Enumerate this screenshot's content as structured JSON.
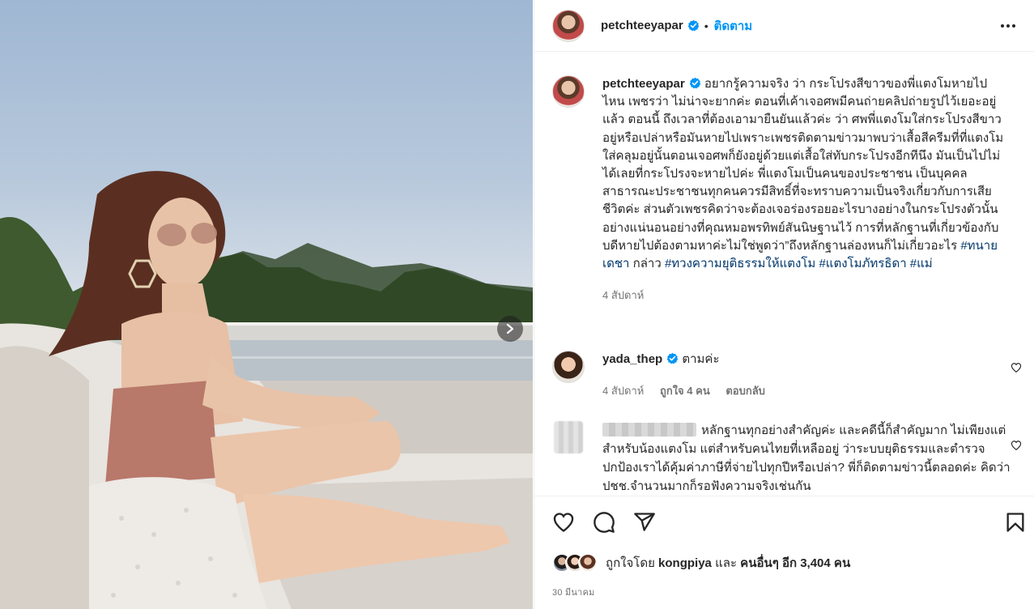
{
  "header": {
    "username": "petchteeyapar",
    "separator": "•",
    "follow_label": "ติดตาม"
  },
  "caption": {
    "username": "petchteeyapar",
    "text": "อยากรู้ความจริง ว่า กระโปรงสีขาวของพี่แตงโมหายไปไหน เพชรว่า ไม่น่าจะยากค่ะ ตอนที่เค้าเจอศพมีคนถ่ายคลิปถ่ายรูปไว้เยอะอยู่แล้ว ตอนนี้ ถึงเวลาที่ต้องเอามายืนยันแล้วค่ะ ว่า ศพพี่แตงโมใส่กระโปรงสีขาวอยู่หรือเปล่าหรือมันหายไปเพราะเพชรติดตามข่าวมาพบว่าเสื้อสีครีมที่ที่แตงโมใส่คลุมอยู่นั้นตอนเจอศพก็ยังอยู่ด้วยแต่เสื้อใส่ทับกระโปรงอีกทีนึง มันเป็นไปไม่ได้เลยที่กระโปรงจะหายไปค่ะ พี่แตงโมเป็นคนของประชาชน เป็นบุคคลสาธารณะประชาชนทุกคนควรมีสิทธิ์ที่จะทราบความเป็นจริงเกี่ยวกับการเสียชีวิตค่ะ ส่วนตัวเพชรคิดว่าจะต้องเจอร่องรอยอะไรบางอย่างในกระโปรงตัวนั้นอย่างแน่นอนอย่างที่คุณหมอพรทิพย์สันนิษฐานไว้ การที่หลักฐานที่เกี่ยวข้องกับบดีหายไปต้องตามหาค่ะไม่ใช่พูดว่า”ถึงหลักฐานล่องหนก็ไม่เกี่ยวอะไร ",
    "hashtag1": "#ทนายเดชา",
    "mid": " กล่าว ",
    "hashtag2": "#ทวงความยุติธรรมให้แตงโม",
    "hashtag3": "#แตงโมภัทรธิดา",
    "hashtag4": "#แม่",
    "time": "4 สัปดาห์"
  },
  "comment1": {
    "username": "yada_thep",
    "text": "ตามค่ะ",
    "time": "4 สัปดาห์",
    "likes": "ถูกใจ 4 คน",
    "reply": "ตอบกลับ"
  },
  "comment2": {
    "text": "หลักฐานทุกอย่างสำคัญค่ะ และคดีนี้ก็สำคัญมาก ไม่เพียงแต่สำหรับน้องแตงโม แต่สำหรับคนไทยที่เหลืออยู่ ว่าระบบยุติธรรมและตำรวจ ปกป้องเราได้คุ้มค่าภาษีที่จ่ายไปทุกปีหรือเปล่า? พี่ก็ติดตามข่าวนี้ตลอดค่ะ คิดว่า ปชช.จำนวนมากก็รอฟังความจริงเช่นกัน"
  },
  "likes": {
    "prefix": "ถูกใจโดย",
    "user": "kongpiya",
    "and": "และ",
    "others": "คนอื่นๆ อีก 3,404 คน"
  },
  "date": "30 มีนาคม",
  "icons": [
    "verified-badge-icon",
    "more-options-icon",
    "next-arrow-icon",
    "heart-icon",
    "comment-icon",
    "share-icon",
    "bookmark-icon"
  ],
  "colors": {
    "link_blue": "#0095f6",
    "hashtag": "#00376b",
    "secondary": "#737373",
    "verified": "#0095f6"
  }
}
